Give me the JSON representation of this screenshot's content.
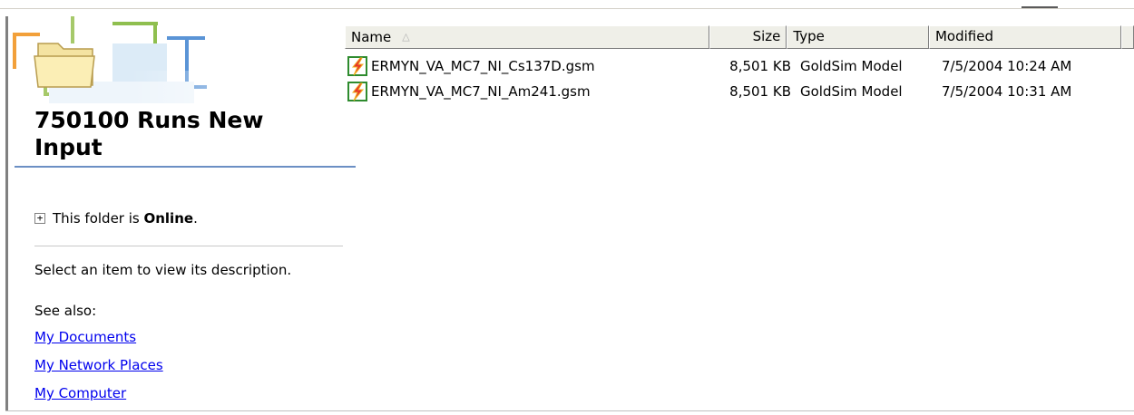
{
  "folder": {
    "title": "750100 Runs New Input",
    "status_prefix": "This folder is ",
    "status_value": "Online",
    "status_suffix": ".",
    "description": "Select an item to view its description.",
    "see_also_label": "See also:",
    "links": [
      "My Documents",
      "My Network Places",
      "My Computer"
    ]
  },
  "list": {
    "columns": [
      "Name",
      "Size",
      "Type",
      "Modified"
    ],
    "sorted_by": "Name",
    "rows": [
      {
        "name": "ERMYN_VA_MC7_NI_Cs137D.gsm",
        "size": "8,501 KB",
        "type": "GoldSim Model",
        "modified": "7/5/2004 10:24 AM"
      },
      {
        "name": "ERMYN_VA_MC7_NI_Am241.gsm",
        "size": "8,501 KB",
        "type": "GoldSim Model",
        "modified": "7/5/2004 10:31 AM"
      }
    ]
  },
  "icons": {
    "folder": "folder-icon",
    "file": "goldsim-file-icon",
    "expand": "plus-box-icon",
    "sort": "sort-ascending-icon"
  },
  "colors": {
    "link": "#0000ee",
    "title_rule": "#6b8fc4",
    "header_bg": "#efefe8",
    "icon_border": "#2e8b2e",
    "icon_bolt": "#e8342a"
  }
}
